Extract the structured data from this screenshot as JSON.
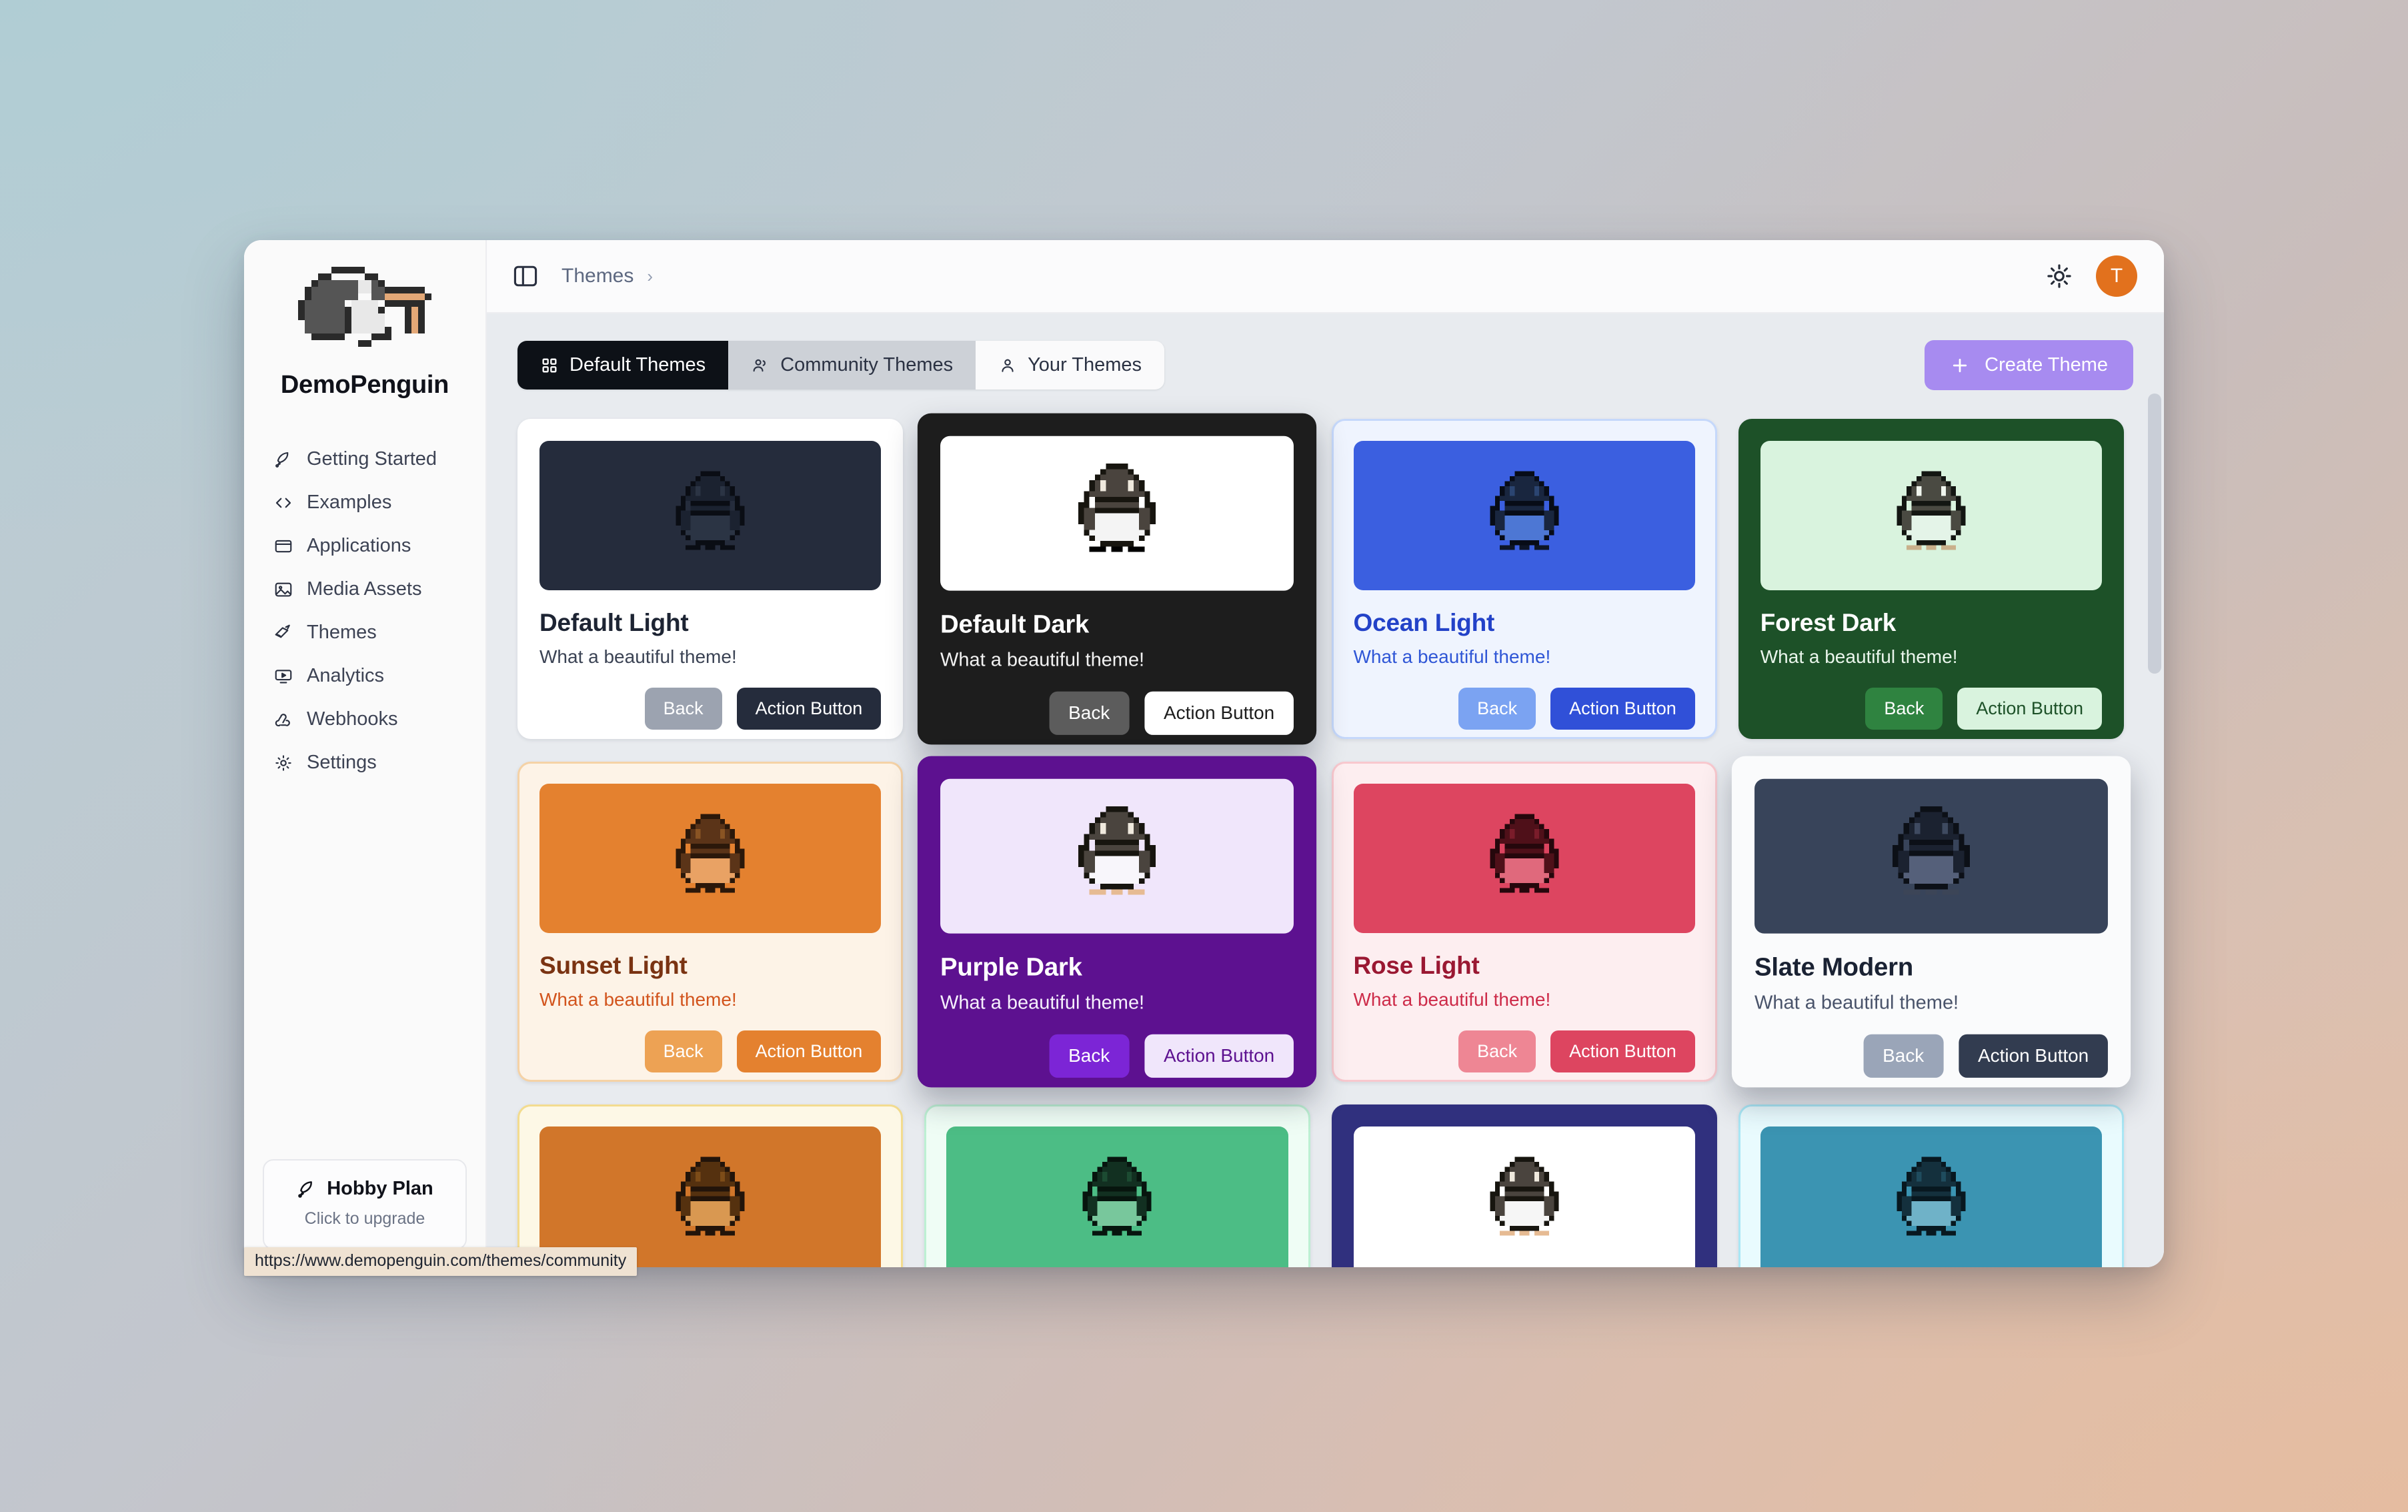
{
  "sidebar": {
    "brand_name": "DemoPenguin",
    "items": [
      {
        "label": "Getting Started",
        "icon": "rocket-icon"
      },
      {
        "label": "Examples",
        "icon": "code-brackets-icon"
      },
      {
        "label": "Applications",
        "icon": "window-icon"
      },
      {
        "label": "Media Assets",
        "icon": "image-icon"
      },
      {
        "label": "Themes",
        "icon": "paintbrush-icon"
      },
      {
        "label": "Analytics",
        "icon": "monitor-play-icon"
      },
      {
        "label": "Webhooks",
        "icon": "webhook-icon"
      },
      {
        "label": "Settings",
        "icon": "gear-icon"
      }
    ],
    "plan": {
      "title": "Hobby Plan",
      "subtitle": "Click to upgrade",
      "icon": "rocket-icon"
    }
  },
  "topbar": {
    "panel_icon": "sidebar-toggle-icon",
    "breadcrumb": [
      "Themes"
    ],
    "breadcrumb_separator": "›",
    "theme_toggle_icon": "sun-icon",
    "avatar_initial": "T",
    "avatar_color": "#e2711d"
  },
  "tabs": [
    {
      "label": "Default Themes",
      "icon": "grid-icon",
      "state": "active"
    },
    {
      "label": "Community Themes",
      "icon": "users-icon",
      "state": "hover"
    },
    {
      "label": "Your Themes",
      "icon": "user-icon",
      "state": "normal"
    }
  ],
  "create_button": {
    "label": "Create Theme",
    "icon": "plus-icon",
    "color": "#a78bf0"
  },
  "card_buttons": {
    "back": "Back",
    "action": "Action Button"
  },
  "status_bar": {
    "url": "https://www.demopenguin.com/themes/community"
  },
  "themes": [
    {
      "name": "Default Light",
      "desc": "What a beautiful theme!",
      "card_bg": "#ffffff",
      "border": "#ffffff",
      "preview_bg": "#252c3c",
      "title_color": "#1d2433",
      "desc_color": "#3b4354",
      "back_bg": "#9ca3b0",
      "back_fg": "#ffffff",
      "action_bg": "#252c3c",
      "action_fg": "#ffffff",
      "peng_body": "#1b2230",
      "peng_belly": "#2b3444",
      "peng_dark": "#0a0d14",
      "peng_foot": "#0a0d14",
      "peng_eye": "#2b3444",
      "raised": false
    },
    {
      "name": "Default Dark",
      "desc": "What a beautiful theme!",
      "card_bg": "#1d1d1d",
      "border": "#1d1d1d",
      "preview_bg": "#ffffff",
      "title_color": "#ffffff",
      "desc_color": "#f2f2f2",
      "back_bg": "#5c5c5c",
      "back_fg": "#ffffff",
      "action_bg": "#ffffff",
      "action_fg": "#1d1d1d",
      "peng_body": "#4a443e",
      "peng_belly": "#f4f4f4",
      "peng_dark": "#17150f",
      "peng_foot": "#e3b municipal",
      "peng_eye": "#efe9dd",
      "raised": true
    },
    {
      "name": "Ocean Light",
      "desc": "What a beautiful theme!",
      "card_bg": "#eff4fe",
      "border": "#c5d8fb",
      "preview_bg": "#3b5fe0",
      "title_color": "#2342c8",
      "desc_color": "#2f56d6",
      "back_bg": "#7ba3f2",
      "back_fg": "#ffffff",
      "action_bg": "#3050d8",
      "action_fg": "#ffffff",
      "peng_body": "#19263f",
      "peng_belly": "#4d77d4",
      "peng_dark": "#070c17",
      "peng_foot": "#0d1526",
      "peng_eye": "#2b4572",
      "raised": false
    },
    {
      "name": "Forest Dark",
      "desc": "What a beautiful theme!",
      "card_bg": "#1d5128",
      "border": "#1d5128",
      "preview_bg": "#d9f3de",
      "title_color": "#ffffff",
      "desc_color": "#eaf6ec",
      "back_bg": "#2f8340",
      "back_fg": "#ffffff",
      "action_bg": "#d9f3de",
      "action_fg": "#1d5128",
      "peng_body": "#4a4a42",
      "peng_belly": "#e4f4e8",
      "peng_dark": "#131612",
      "peng_foot": "#c9b08b",
      "peng_eye": "#f0f6ee",
      "raised": false
    },
    {
      "name": "Sunset Light",
      "desc": "What a beautiful theme!",
      "card_bg": "#fdf3e7",
      "border": "#f5d2a6",
      "preview_bg": "#e4812f",
      "title_color": "#7a3312",
      "desc_color": "#d2541d",
      "back_bg": "#eda254",
      "back_fg": "#ffffff",
      "action_bg": "#e4812f",
      "action_fg": "#ffffff",
      "peng_body": "#5b3418",
      "peng_belly": "#e9a264",
      "peng_dark": "#2b180a",
      "peng_foot": "#2b180a",
      "peng_eye": "#8a5423",
      "raised": false
    },
    {
      "name": "Purple Dark",
      "desc": "What a beautiful theme!",
      "card_bg": "#5d1190",
      "border": "#5d1190",
      "preview_bg": "#f0e6fb",
      "title_color": "#ffffff",
      "desc_color": "#f6f0fd",
      "back_bg": "#7c25d6",
      "back_fg": "#ffffff",
      "action_bg": "#f0e6fb",
      "action_fg": "#5d1190",
      "peng_body": "#4a443e",
      "peng_belly": "#f8f6fb",
      "peng_dark": "#17150f",
      "peng_foot": "#e6bb93",
      "peng_eye": "#efe9dd",
      "raised": true
    },
    {
      "name": "Rose Light",
      "desc": "What a beautiful theme!",
      "card_bg": "#fdeef0",
      "border": "#f8c8ce",
      "preview_bg": "#dd4560",
      "title_color": "#9a1832",
      "desc_color": "#cd2b49",
      "back_bg": "#ee8694",
      "back_fg": "#ffffff",
      "action_bg": "#dd4560",
      "action_fg": "#ffffff",
      "peng_body": "#4f1019",
      "peng_belly": "#e0697c",
      "peng_dark": "#25070c",
      "peng_foot": "#25070c",
      "peng_eye": "#7a1c2a",
      "raised": false
    },
    {
      "name": "Slate Modern",
      "desc": "What a beautiful theme!",
      "card_bg": "#fafbfc",
      "border": "#fafbfc",
      "preview_bg": "#38445a",
      "title_color": "#1a2233",
      "desc_color": "#49536a",
      "back_bg": "#9aa5b8",
      "back_fg": "#ffffff",
      "action_bg": "#323c50",
      "action_fg": "#ffffff",
      "peng_body": "#1b2230",
      "peng_belly": "#55607a",
      "peng_dark": "#0c1017",
      "peng_foot": "#3c4557",
      "peng_eye": "#3e4a60",
      "raised": true
    },
    {
      "name": "",
      "desc": "",
      "card_bg": "#fdf8e6",
      "border": "#f3dc8f",
      "preview_bg": "#d1762a",
      "title_color": "#7a3312",
      "desc_color": "#d2541d",
      "back_bg": "#eda254",
      "back_fg": "#ffffff",
      "action_bg": "#d1762a",
      "action_fg": "#ffffff",
      "peng_body": "#55310f",
      "peng_belly": "#d99851",
      "peng_dark": "#22140a",
      "peng_foot": "#22140a",
      "peng_eye": "#7d4c18",
      "raised": false,
      "partial": true
    },
    {
      "name": "",
      "desc": "",
      "card_bg": "#effdf5",
      "border": "#bdf0d3",
      "preview_bg": "#4cbd85",
      "title_color": "#14623d",
      "desc_color": "#1d8754",
      "back_bg": "#7fd4a9",
      "back_fg": "#ffffff",
      "action_bg": "#4cbd85",
      "action_fg": "#ffffff",
      "peng_body": "#123021",
      "peng_belly": "#78c79c",
      "peng_dark": "#07150e",
      "peng_foot": "#07150e",
      "peng_eye": "#1c4b32",
      "raised": false,
      "partial": true
    },
    {
      "name": "",
      "desc": "",
      "card_bg": "#30307e",
      "border": "#30307e",
      "preview_bg": "#ffffff",
      "title_color": "#ffffff",
      "desc_color": "#e9e9f8",
      "back_bg": "#4b4bb5",
      "back_fg": "#ffffff",
      "action_bg": "#ffffff",
      "action_fg": "#30307e",
      "peng_body": "#4a443e",
      "peng_belly": "#f6f6f6",
      "peng_dark": "#17150f",
      "peng_foot": "#e6bb93",
      "peng_eye": "#efe9dd",
      "raised": false,
      "partial": true
    },
    {
      "name": "",
      "desc": "",
      "card_bg": "#e9fbfe",
      "border": "#a9e7f5",
      "preview_bg": "#3b94b2",
      "title_color": "#135a72",
      "desc_color": "#1b7a99",
      "back_bg": "#79c2d8",
      "back_fg": "#ffffff",
      "action_bg": "#3b94b2",
      "action_fg": "#ffffff",
      "peng_body": "#14303d",
      "peng_belly": "#6fb2c8",
      "peng_dark": "#081820",
      "peng_foot": "#081820",
      "peng_eye": "#1f4c5e",
      "raised": false,
      "partial": true
    }
  ]
}
